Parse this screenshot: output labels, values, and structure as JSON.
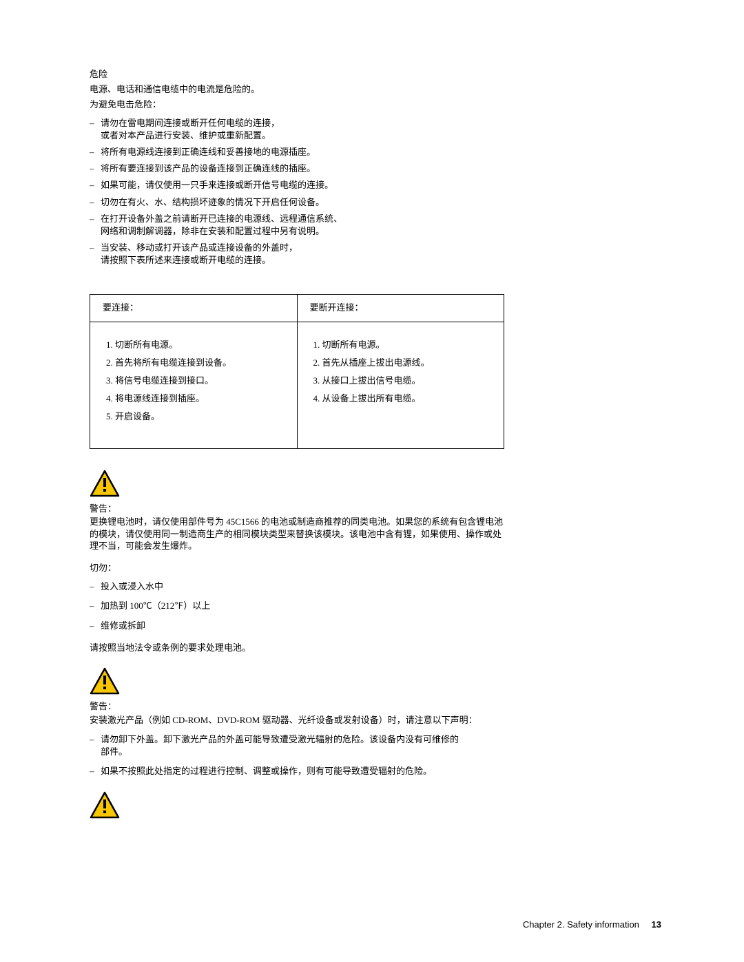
{
  "danger": {
    "title": "危险",
    "line1": "电源、电话和通信电缆中的电流是危险的。",
    "line2": "为避免电击危险：",
    "items": [
      "请勿在雷电期间连接或断开任何电缆的连接，\n或者对本产品进行安装、维护或重新配置。",
      "将所有电源线连接到正确连线和妥善接地的电源插座。",
      "将所有要连接到该产品的设备连接到正确连线的插座。",
      "如果可能，请仅使用一只手来连接或断开信号电缆的连接。",
      "切勿在有火、水、结构损坏迹象的情况下开启任何设备。",
      "在打开设备外盖之前请断开已连接的电源线、远程通信系统、\n网络和调制解调器，除非在安装和配置过程中另有说明。",
      "当安装、移动或打开该产品或连接设备的外盖时，\n请按照下表所述来连接或断开电缆的连接。"
    ]
  },
  "table": {
    "head_left": "要连接：",
    "head_right": "要断开连接：",
    "left": [
      "切断所有电源。",
      "首先将所有电缆连接到设备。",
      "将信号电缆连接到接口。",
      "将电源线连接到插座。",
      "开启设备。"
    ],
    "right": [
      "切断所有电源。",
      "首先从插座上拔出电源线。",
      "从接口上拔出信号电缆。",
      "从设备上拔出所有电缆。"
    ]
  },
  "caution1": {
    "label": "警告：",
    "body": "更换锂电池时，请仅使用部件号为 45C1566 的电池或制造商推荐的同类电池。如果您的系统有包含锂电池的模块，请仅使用同一制造商生产的相同模块类型来替换该模块。该电池中含有锂，如果使用、操作或处理不当，可能会发生爆炸。",
    "never": "切勿：",
    "items": [
      "投入或浸入水中",
      "加热到 100℃（212℉）以上",
      "维修或拆卸"
    ],
    "tail": "请按照当地法令或条例的要求处理电池。"
  },
  "caution2": {
    "label": "警告：",
    "body": "安装激光产品（例如 CD-ROM、DVD-ROM 驱动器、光纤设备或发射设备）时，请注意以下声明：",
    "items": [
      "请勿卸下外盖。卸下激光产品的外盖可能导致遭受激光辐射的危险。该设备内没有可维修的部件。",
      "如果不按照此处指定的过程进行控制、调整或操作，则有可能导致遭受辐射的危险。"
    ]
  },
  "footer": {
    "chapter": "Chapter 2. Safety information",
    "page": "13"
  }
}
